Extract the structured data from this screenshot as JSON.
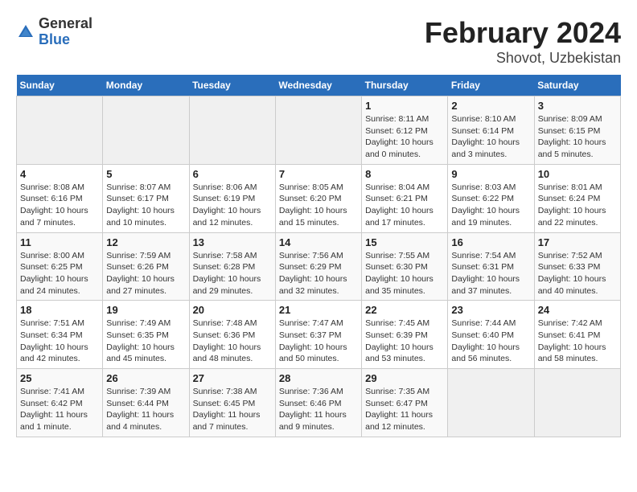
{
  "header": {
    "logo_general": "General",
    "logo_blue": "Blue",
    "title": "February 2024",
    "subtitle": "Shovot, Uzbekistan"
  },
  "weekdays": [
    "Sunday",
    "Monday",
    "Tuesday",
    "Wednesday",
    "Thursday",
    "Friday",
    "Saturday"
  ],
  "weeks": [
    [
      {
        "day": "",
        "info": ""
      },
      {
        "day": "",
        "info": ""
      },
      {
        "day": "",
        "info": ""
      },
      {
        "day": "",
        "info": ""
      },
      {
        "day": "1",
        "info": "Sunrise: 8:11 AM\nSunset: 6:12 PM\nDaylight: 10 hours and 0 minutes."
      },
      {
        "day": "2",
        "info": "Sunrise: 8:10 AM\nSunset: 6:14 PM\nDaylight: 10 hours and 3 minutes."
      },
      {
        "day": "3",
        "info": "Sunrise: 8:09 AM\nSunset: 6:15 PM\nDaylight: 10 hours and 5 minutes."
      }
    ],
    [
      {
        "day": "4",
        "info": "Sunrise: 8:08 AM\nSunset: 6:16 PM\nDaylight: 10 hours and 7 minutes."
      },
      {
        "day": "5",
        "info": "Sunrise: 8:07 AM\nSunset: 6:17 PM\nDaylight: 10 hours and 10 minutes."
      },
      {
        "day": "6",
        "info": "Sunrise: 8:06 AM\nSunset: 6:19 PM\nDaylight: 10 hours and 12 minutes."
      },
      {
        "day": "7",
        "info": "Sunrise: 8:05 AM\nSunset: 6:20 PM\nDaylight: 10 hours and 15 minutes."
      },
      {
        "day": "8",
        "info": "Sunrise: 8:04 AM\nSunset: 6:21 PM\nDaylight: 10 hours and 17 minutes."
      },
      {
        "day": "9",
        "info": "Sunrise: 8:03 AM\nSunset: 6:22 PM\nDaylight: 10 hours and 19 minutes."
      },
      {
        "day": "10",
        "info": "Sunrise: 8:01 AM\nSunset: 6:24 PM\nDaylight: 10 hours and 22 minutes."
      }
    ],
    [
      {
        "day": "11",
        "info": "Sunrise: 8:00 AM\nSunset: 6:25 PM\nDaylight: 10 hours and 24 minutes."
      },
      {
        "day": "12",
        "info": "Sunrise: 7:59 AM\nSunset: 6:26 PM\nDaylight: 10 hours and 27 minutes."
      },
      {
        "day": "13",
        "info": "Sunrise: 7:58 AM\nSunset: 6:28 PM\nDaylight: 10 hours and 29 minutes."
      },
      {
        "day": "14",
        "info": "Sunrise: 7:56 AM\nSunset: 6:29 PM\nDaylight: 10 hours and 32 minutes."
      },
      {
        "day": "15",
        "info": "Sunrise: 7:55 AM\nSunset: 6:30 PM\nDaylight: 10 hours and 35 minutes."
      },
      {
        "day": "16",
        "info": "Sunrise: 7:54 AM\nSunset: 6:31 PM\nDaylight: 10 hours and 37 minutes."
      },
      {
        "day": "17",
        "info": "Sunrise: 7:52 AM\nSunset: 6:33 PM\nDaylight: 10 hours and 40 minutes."
      }
    ],
    [
      {
        "day": "18",
        "info": "Sunrise: 7:51 AM\nSunset: 6:34 PM\nDaylight: 10 hours and 42 minutes."
      },
      {
        "day": "19",
        "info": "Sunrise: 7:49 AM\nSunset: 6:35 PM\nDaylight: 10 hours and 45 minutes."
      },
      {
        "day": "20",
        "info": "Sunrise: 7:48 AM\nSunset: 6:36 PM\nDaylight: 10 hours and 48 minutes."
      },
      {
        "day": "21",
        "info": "Sunrise: 7:47 AM\nSunset: 6:37 PM\nDaylight: 10 hours and 50 minutes."
      },
      {
        "day": "22",
        "info": "Sunrise: 7:45 AM\nSunset: 6:39 PM\nDaylight: 10 hours and 53 minutes."
      },
      {
        "day": "23",
        "info": "Sunrise: 7:44 AM\nSunset: 6:40 PM\nDaylight: 10 hours and 56 minutes."
      },
      {
        "day": "24",
        "info": "Sunrise: 7:42 AM\nSunset: 6:41 PM\nDaylight: 10 hours and 58 minutes."
      }
    ],
    [
      {
        "day": "25",
        "info": "Sunrise: 7:41 AM\nSunset: 6:42 PM\nDaylight: 11 hours and 1 minute."
      },
      {
        "day": "26",
        "info": "Sunrise: 7:39 AM\nSunset: 6:44 PM\nDaylight: 11 hours and 4 minutes."
      },
      {
        "day": "27",
        "info": "Sunrise: 7:38 AM\nSunset: 6:45 PM\nDaylight: 11 hours and 7 minutes."
      },
      {
        "day": "28",
        "info": "Sunrise: 7:36 AM\nSunset: 6:46 PM\nDaylight: 11 hours and 9 minutes."
      },
      {
        "day": "29",
        "info": "Sunrise: 7:35 AM\nSunset: 6:47 PM\nDaylight: 11 hours and 12 minutes."
      },
      {
        "day": "",
        "info": ""
      },
      {
        "day": "",
        "info": ""
      }
    ]
  ]
}
